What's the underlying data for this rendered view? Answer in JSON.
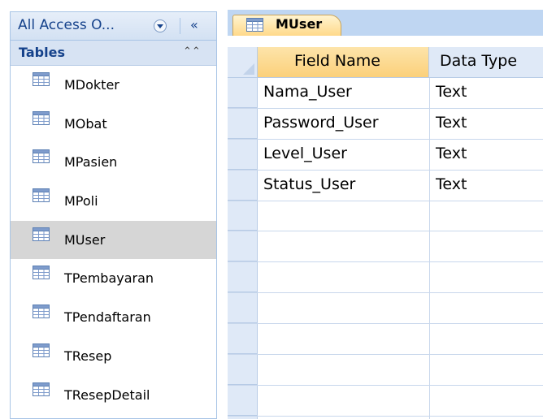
{
  "nav": {
    "title": "All Access O...",
    "shutter": "«",
    "group": {
      "label": "Tables",
      "collapse": "⌃⌃"
    },
    "items": [
      {
        "label": "MDokter"
      },
      {
        "label": "MObat"
      },
      {
        "label": "MPasien"
      },
      {
        "label": "MPoli"
      },
      {
        "label": "MUser",
        "selected": true
      },
      {
        "label": "TPembayaran"
      },
      {
        "label": "TPendaftaran"
      },
      {
        "label": "TResep"
      },
      {
        "label": "TResepDetail"
      }
    ]
  },
  "tab": {
    "label": "MUser",
    "icon": "table-icon"
  },
  "grid": {
    "columns": [
      "Field Name",
      "Data Type"
    ],
    "rows": [
      {
        "field": "Nama_User",
        "type": "Text"
      },
      {
        "field": "Password_User",
        "type": "Text"
      },
      {
        "field": "Level_User",
        "type": "Text"
      },
      {
        "field": "Status_User",
        "type": "Text"
      },
      {
        "field": "",
        "type": ""
      },
      {
        "field": "",
        "type": ""
      },
      {
        "field": "",
        "type": ""
      },
      {
        "field": "",
        "type": ""
      },
      {
        "field": "",
        "type": ""
      },
      {
        "field": "",
        "type": ""
      },
      {
        "field": "",
        "type": ""
      }
    ]
  },
  "colors": {
    "accent": "#15428b",
    "selected_tab": "#ffd98a",
    "selected_item": "#d6d6d6"
  }
}
